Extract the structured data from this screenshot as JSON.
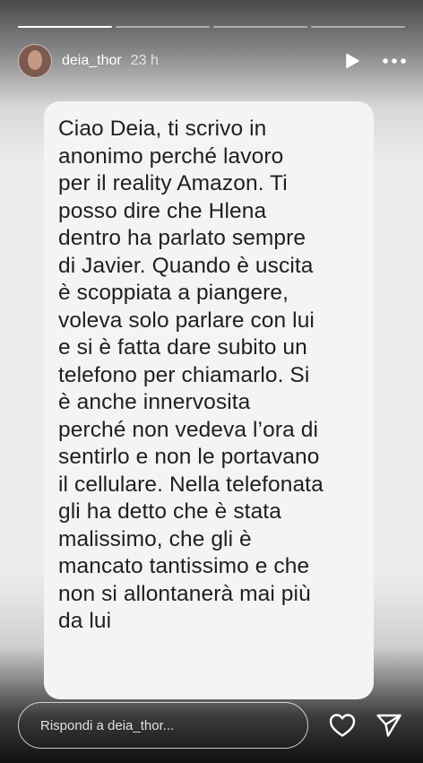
{
  "story": {
    "progress": {
      "segments": 4,
      "current": 1
    },
    "user": {
      "username": "deia_thor",
      "time": "23 h"
    },
    "message": "Ciao Deia, ti scrivo in\nanonimo perché lavoro\nper il reality Amazon. Ti\nposso dire che Hlena\ndentro ha parlato sempre\ndi Javier. Quando è uscita\nè scoppiata a piangere,\nvoleva solo parlare con lui\ne si è fatta dare subito un\ntelefono per chiamarlo. Si\nè anche innervosita\nperché non vedeva l’ora di\nsentirlo e non le portavano\nil cellulare. Nella telefonata\ngli ha detto che è stata\nmalissimo, che gli è\nmancato tantissimo e che\nnon si allontanerà mai più\nda lui",
    "reply": {
      "placeholder": "Rispondi a deia_thor..."
    },
    "icons": {
      "play": "play-icon",
      "more": "more-icon",
      "like": "heart-icon",
      "send": "send-icon"
    }
  }
}
